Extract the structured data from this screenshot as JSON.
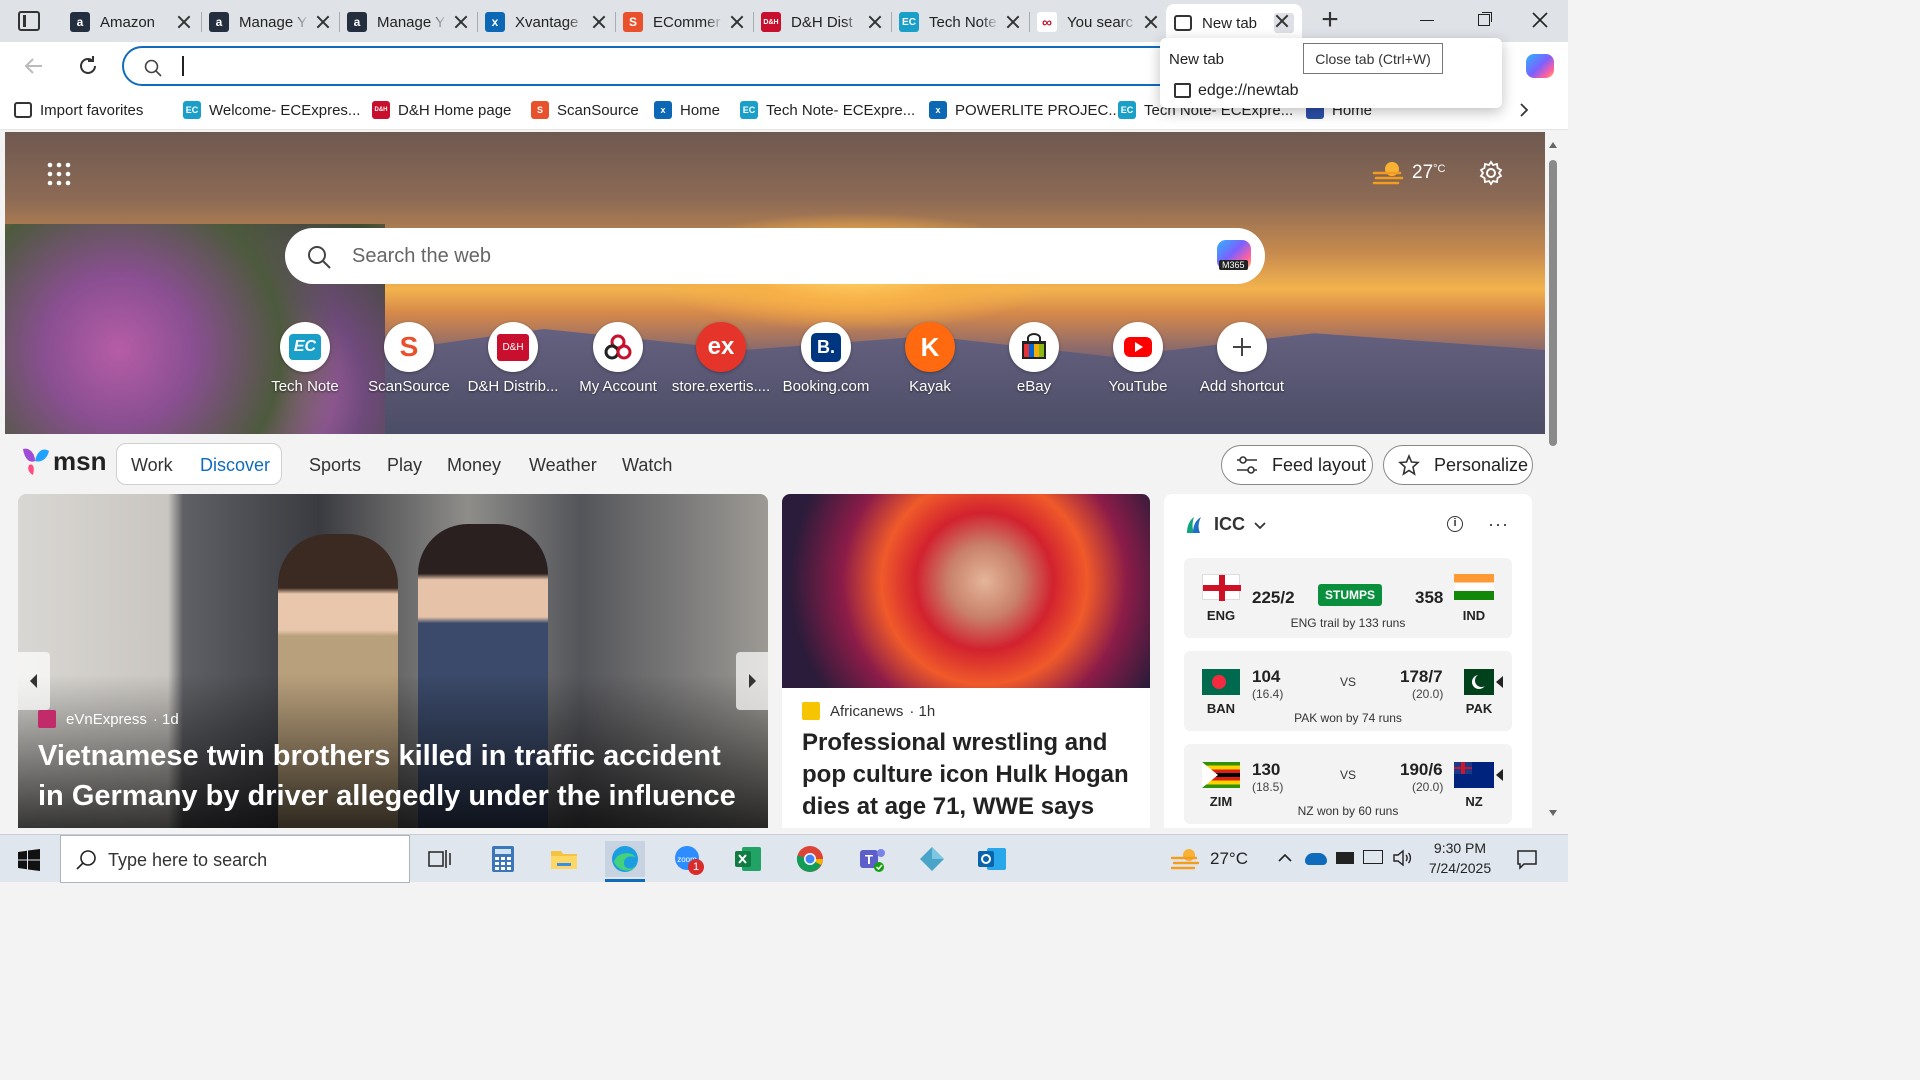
{
  "browser": {
    "tabs": [
      {
        "title": "Amazon",
        "icon": "amazon-icon",
        "color": "#232f3e"
      },
      {
        "title": "Manage Y",
        "icon": "amazon-icon",
        "color": "#232f3e"
      },
      {
        "title": "Manage Y",
        "icon": "amazon-icon",
        "color": "#232f3e"
      },
      {
        "title": "Xvantage",
        "icon": "xvantage-icon",
        "color": "#0c68b4"
      },
      {
        "title": "ECommer",
        "icon": "scansource-icon",
        "color": "#e9512c"
      },
      {
        "title": "D&H Dist",
        "icon": "dh-icon",
        "color": "#c8102e"
      },
      {
        "title": "Tech Note",
        "icon": "ec-icon",
        "color": "#1aa0c8"
      },
      {
        "title": "You searc",
        "icon": "myaccount-icon",
        "color": "#c8102e"
      },
      {
        "title": "New tab",
        "icon": "newtab-icon",
        "color": "#333333"
      }
    ],
    "new_tab_label": "+",
    "address_value": "",
    "tab_popup": {
      "title": "New tab",
      "url": "edge://newtab"
    },
    "tooltip": "Close tab (Ctrl+W)"
  },
  "favorites_bar": {
    "items": [
      {
        "label": "Import favorites",
        "icon": "import-icon"
      },
      {
        "label": "Welcome- ECExpres...",
        "icon": "ec-icon"
      },
      {
        "label": "D&H Home page",
        "icon": "dh-icon"
      },
      {
        "label": "ScanSource",
        "icon": "scansource-icon"
      },
      {
        "label": "Home",
        "icon": "xvantage-icon"
      },
      {
        "label": "Tech Note- ECExpre...",
        "icon": "ec-icon"
      },
      {
        "label": "POWERLITE PROJEC...",
        "icon": "xvantage-icon"
      },
      {
        "label": "Tech Note- ECExpre...",
        "icon": "ec-icon"
      },
      {
        "label": "Home",
        "icon": "flag-icon"
      }
    ]
  },
  "newtab": {
    "weather": {
      "temp": "27",
      "unit": "°C"
    },
    "search_placeholder": "Search the web",
    "search_badge": "M365",
    "shortcuts": [
      {
        "label": "Tech Note",
        "icon": "ec-icon",
        "glyph": "EC",
        "color": "#1aa0c8"
      },
      {
        "label": "ScanSource",
        "icon": "scansource-icon",
        "glyph": "S",
        "color": "#e9512c"
      },
      {
        "label": "D&H Distrib...",
        "icon": "dh-icon",
        "glyph": "D&H",
        "color": "#c8102e"
      },
      {
        "label": "My Account",
        "icon": "myaccount-icon",
        "glyph": "∞",
        "color": "#c8102e"
      },
      {
        "label": "store.exertis....",
        "icon": "exertis-icon",
        "glyph": "ex",
        "color": "#e5352b"
      },
      {
        "label": "Booking.com",
        "icon": "booking-icon",
        "glyph": "B.",
        "color": "#003580"
      },
      {
        "label": "Kayak",
        "icon": "kayak-icon",
        "glyph": "K",
        "color": "#ff690f"
      },
      {
        "label": "eBay",
        "icon": "ebay-icon",
        "glyph": "▮",
        "color": "#222222"
      },
      {
        "label": "YouTube",
        "icon": "youtube-icon",
        "glyph": "▶",
        "color": "#ff0000"
      },
      {
        "label": "Add shortcut",
        "icon": "plus-icon",
        "glyph": "+",
        "color": "#444444"
      }
    ]
  },
  "msn": {
    "logo": "msn",
    "tabs": [
      "Work",
      "Discover",
      "Sports",
      "Play",
      "Money",
      "Weather",
      "Watch"
    ],
    "feed_layout": "Feed layout",
    "personalize": "Personalize"
  },
  "feed": {
    "main_story": {
      "source": "eVnExpress",
      "age": "· 1d",
      "headline": "Vietnamese twin brothers killed in traffic accident in Germany by driver allegedly under the influence of..."
    },
    "second_story": {
      "source": "Africanews",
      "age": "· 1h",
      "headline": "Professional wrestling and pop culture icon Hulk Hogan dies at age 71, WWE says"
    },
    "cricket": {
      "title": "ICC",
      "matches": [
        {
          "team1": "ENG",
          "score1": "225/2",
          "overs1": "",
          "status": "STUMPS",
          "team2": "IND",
          "score2": "358",
          "overs2": "",
          "result": "ENG trail by 133 runs"
        },
        {
          "team1": "BAN",
          "score1": "104",
          "overs1": "(16.4)",
          "status": "VS",
          "team2": "PAK",
          "score2": "178/7",
          "overs2": "(20.0)",
          "result": "PAK won by 74 runs"
        },
        {
          "team1": "ZIM",
          "score1": "130",
          "overs1": "(18.5)",
          "status": "VS",
          "team2": "NZ",
          "score2": "190/6",
          "overs2": "(20.0)",
          "result": "NZ won by 60 runs"
        }
      ]
    }
  },
  "taskbar": {
    "search_placeholder": "Type here to search",
    "weather": "27°C",
    "time": "9:30 PM",
    "date": "7/24/2025",
    "zoom_badge": "1"
  }
}
